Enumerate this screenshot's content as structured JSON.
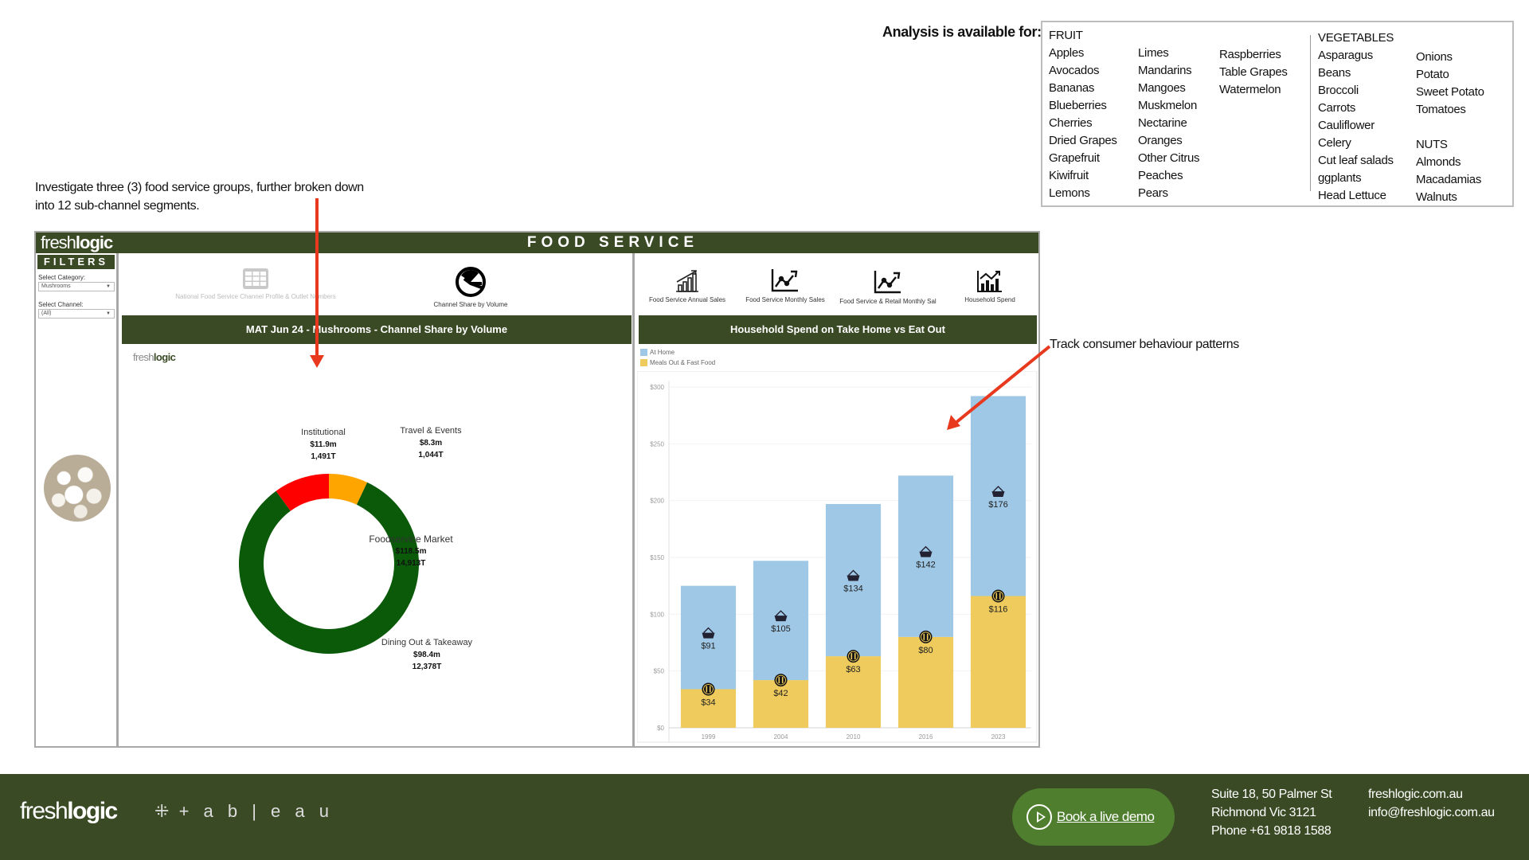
{
  "analysis": {
    "label": "Analysis is available for:",
    "fruit": {
      "heading": "FRUIT",
      "col1": [
        "Apples",
        "Avocados",
        "Bananas",
        "Blueberries",
        "Cherries",
        "Dried Grapes",
        "Grapefruit",
        "Kiwifruit",
        "Lemons"
      ],
      "col2": [
        "Limes",
        "Mandarins",
        "Mangoes",
        "Muskmelon",
        "Nectarine",
        "Oranges",
        "Other Citrus",
        "Peaches",
        "Pears"
      ],
      "col3": [
        "Raspberries",
        "Table Grapes",
        "Watermelon"
      ]
    },
    "vegetables": {
      "heading": "VEGETABLES",
      "col1": [
        "Asparagus",
        "Beans",
        "Broccoli",
        "Carrots",
        "Cauliflower",
        "Celery",
        "Cut leaf salads",
        "ggplants",
        "Head Lettuce"
      ],
      "col2": [
        "Onions",
        "Potato",
        "Sweet Potato",
        "Tomatoes"
      ]
    },
    "nuts": {
      "heading": "NUTS",
      "items": [
        "Almonds",
        "Macadamias",
        "Walnuts"
      ]
    }
  },
  "captions": {
    "left": "Investigate three (3) food service groups, further broken down into 12 sub-channel segments.",
    "right": "Track consumer behaviour patterns"
  },
  "dashboard": {
    "logo_light": "fresh",
    "logo_bold": "logic",
    "title": "FOOD SERVICE",
    "filters": {
      "title": "FILTERS",
      "category_label": "Select Category:",
      "category_value": "Mushrooms",
      "channel_label": "Select Channel:",
      "channel_value": "(All)"
    },
    "left_nav": [
      {
        "label": "National Food Service Channel Profile & Outlet Numbers",
        "icon": "table-icon",
        "active": false
      },
      {
        "label": "Channel Share by Volume",
        "icon": "pie-chart-icon",
        "active": true
      }
    ],
    "right_nav": [
      {
        "label": "Food Service Annual Sales",
        "icon": "bar-growth-icon"
      },
      {
        "label": "Food Service Monthly Sales",
        "icon": "line-chart-icon"
      },
      {
        "label": "Food Service & Retail Monthly Sal",
        "icon": "line-chart-icon"
      },
      {
        "label": "Household Spend",
        "icon": "bar-line-chart-icon"
      }
    ],
    "left_banner": "MAT Jun 24 - Mushrooms - Channel Share by Volume",
    "right_banner": "Household Spend on Take Home vs Eat Out",
    "mini_logo_light": "fresh",
    "mini_logo_bold": "logic"
  },
  "chart_data": [
    {
      "type": "pie",
      "title": "MAT Jun 24 - Mushrooms - Channel Share by Volume",
      "center_label": {
        "name": "Foodservice Market",
        "value": "$118.5m",
        "volume": "14,913T"
      },
      "slices": [
        {
          "name": "Institutional",
          "value_label": "$11.9m",
          "volume_label": "1,491T",
          "volume": 1491,
          "color": "#ff0000"
        },
        {
          "name": "Travel & Events",
          "value_label": "$8.3m",
          "volume_label": "1,044T",
          "volume": 1044,
          "color": "#ffa500"
        },
        {
          "name": "Dining Out & Takeaway",
          "value_label": "$98.4m",
          "volume_label": "12,378T",
          "volume": 12378,
          "color": "#0a5a0a"
        }
      ],
      "slice_order_clockwise_from_top": [
        "Travel & Events",
        "Dining Out & Takeaway",
        "Institutional"
      ]
    },
    {
      "type": "bar",
      "stacked": true,
      "title": "Household Spend on Take Home vs Eat Out",
      "categories": [
        "1999",
        "2004",
        "2010",
        "2016",
        "2023"
      ],
      "series": [
        {
          "name": "Meals Out & Fast Food",
          "color": "#eecb5c",
          "values": [
            34,
            42,
            63,
            80,
            116
          ],
          "labels": [
            "$34",
            "$42",
            "$63",
            "$80",
            "$116"
          ],
          "icon": "cutlery-icon"
        },
        {
          "name": "At Home",
          "color": "#9fc8e6",
          "values": [
            91,
            105,
            134,
            142,
            176
          ],
          "labels": [
            "$91",
            "$105",
            "$134",
            "$142",
            "$176"
          ],
          "icon": "basket-icon"
        }
      ],
      "legend": [
        "At Home",
        "Meals Out & Fast Food"
      ],
      "legend_position": "top-left",
      "yticks": [
        "$0",
        "$50",
        "$100",
        "$150",
        "$200",
        "$250",
        "$300"
      ],
      "ylim": [
        0,
        300
      ],
      "grid": true
    }
  ],
  "footer": {
    "logo_light": "fresh",
    "logo_bold": "logic",
    "partner": "+ a b | e a u",
    "demo_label": "Book a live demo",
    "address": [
      "Suite 18, 50 Palmer St",
      "Richmond Vic 3121",
      "Phone +61 9818 1588"
    ],
    "contact": [
      "freshlogic.com.au",
      "info@freshlogic.com.au"
    ]
  },
  "colors": {
    "brand_green": "#3a4a25",
    "annotation_red": "#e8391f",
    "demo_green": "#4f7f2e"
  }
}
